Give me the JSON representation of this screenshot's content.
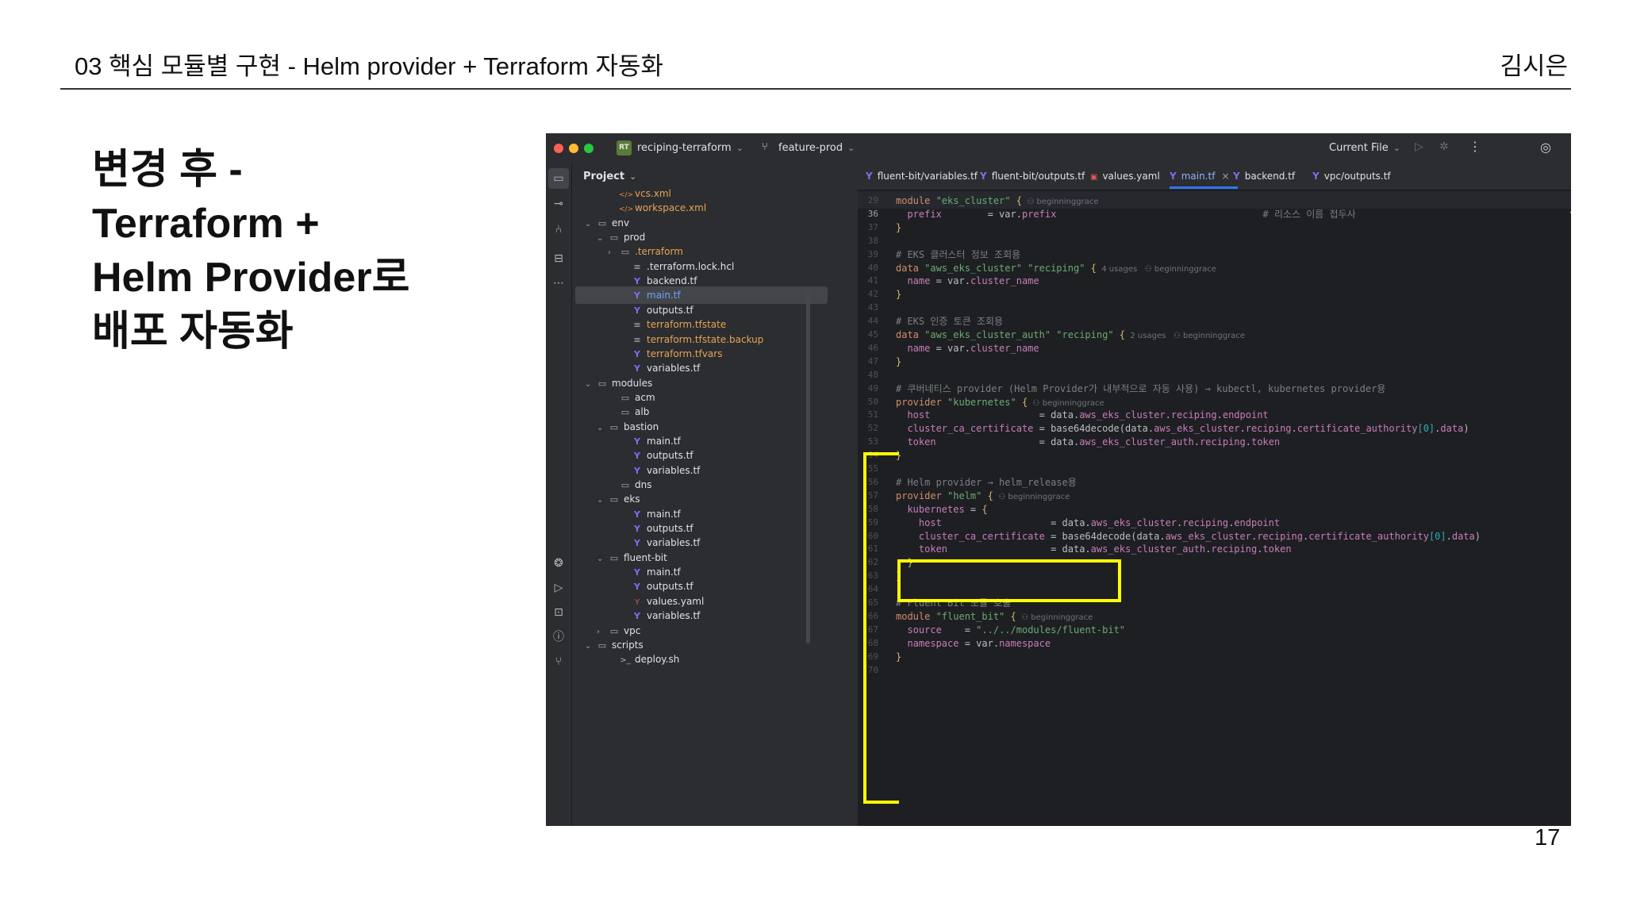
{
  "slide": {
    "title": "03 핵심 모듈별 구현 - Helm provider +  Terraform 자동화",
    "author": "김시은",
    "heading_lines": [
      "변경 후 -",
      "Terraform +",
      "Helm Provider로",
      "배포 자동화"
    ],
    "page_number": "17"
  },
  "ide": {
    "titlebar": {
      "project_badge": "RT",
      "project_name": "reciping-terraform",
      "branch_name": "feature-prod",
      "run_config": "Current File",
      "icons": [
        "chevron-down-icon",
        "git-branch-icon",
        "run-icon",
        "debug-icon",
        "more-icon",
        "ai-assistant-icon"
      ]
    },
    "toolstrip_icons": [
      "folder-icon",
      "commit-icon",
      "pull-request-icon",
      "structure-icon",
      "more-icon",
      "plugins-icon",
      "run-icon",
      "terminal-icon",
      "problems-icon",
      "git-icon"
    ],
    "project_panel": {
      "title": "Project",
      "tree": [
        {
          "label": "vcs.xml",
          "icon": "xml-file-icon",
          "depth": 3,
          "color": "orange"
        },
        {
          "label": "workspace.xml",
          "icon": "xml-file-icon",
          "depth": 3,
          "color": "orange"
        },
        {
          "label": "env",
          "icon": "folder-icon",
          "depth": 1,
          "expanded": true
        },
        {
          "label": "prod",
          "icon": "folder-icon",
          "depth": 2,
          "expanded": true
        },
        {
          "label": ".terraform",
          "icon": "folder-icon",
          "depth": 3,
          "expanded": false,
          "color": "orange"
        },
        {
          "label": ".terraform.lock.hcl",
          "icon": "lines-file-icon",
          "depth": 4
        },
        {
          "label": "backend.tf",
          "icon": "terraform-file-icon",
          "depth": 4
        },
        {
          "label": "main.tf",
          "icon": "terraform-file-icon",
          "depth": 4,
          "selected": true,
          "color": "blue"
        },
        {
          "label": "outputs.tf",
          "icon": "terraform-file-icon",
          "depth": 4
        },
        {
          "label": "terraform.tfstate",
          "icon": "lines-file-icon",
          "depth": 4,
          "color": "orange"
        },
        {
          "label": "terraform.tfstate.backup",
          "icon": "lines-file-icon",
          "depth": 4,
          "color": "orange"
        },
        {
          "label": "terraform.tfvars",
          "icon": "terraform-file-icon",
          "depth": 4,
          "color": "orange"
        },
        {
          "label": "variables.tf",
          "icon": "terraform-file-icon",
          "depth": 4
        },
        {
          "label": "modules",
          "icon": "folder-icon",
          "depth": 1,
          "expanded": true
        },
        {
          "label": "acm",
          "icon": "folder-icon",
          "depth": 3
        },
        {
          "label": "alb",
          "icon": "folder-icon",
          "depth": 3
        },
        {
          "label": "bastion",
          "icon": "folder-icon",
          "depth": 2,
          "expanded": true
        },
        {
          "label": "main.tf",
          "icon": "terraform-file-icon",
          "depth": 4
        },
        {
          "label": "outputs.tf",
          "icon": "terraform-file-icon",
          "depth": 4
        },
        {
          "label": "variables.tf",
          "icon": "terraform-file-icon",
          "depth": 4
        },
        {
          "label": "dns",
          "icon": "folder-icon",
          "depth": 3
        },
        {
          "label": "eks",
          "icon": "folder-icon",
          "depth": 2,
          "expanded": true
        },
        {
          "label": "main.tf",
          "icon": "terraform-file-icon",
          "depth": 4
        },
        {
          "label": "outputs.tf",
          "icon": "terraform-file-icon",
          "depth": 4
        },
        {
          "label": "variables.tf",
          "icon": "terraform-file-icon",
          "depth": 4
        },
        {
          "label": "fluent-bit",
          "icon": "folder-icon",
          "depth": 2,
          "expanded": true
        },
        {
          "label": "main.tf",
          "icon": "terraform-file-icon",
          "depth": 4
        },
        {
          "label": "outputs.tf",
          "icon": "terraform-file-icon",
          "depth": 4
        },
        {
          "label": "values.yaml",
          "icon": "yaml-file-icon",
          "depth": 4
        },
        {
          "label": "variables.tf",
          "icon": "terraform-file-icon",
          "depth": 4
        },
        {
          "label": "vpc",
          "icon": "folder-icon",
          "depth": 2,
          "expanded": false
        },
        {
          "label": "scripts",
          "icon": "folder-icon",
          "depth": 1,
          "expanded": true
        },
        {
          "label": "deploy.sh",
          "icon": "shell-file-icon",
          "depth": 3
        }
      ]
    },
    "tabs": [
      {
        "label": "fluent-bit/variables.tf",
        "icon": "terraform-file-icon"
      },
      {
        "label": "fluent-bit/outputs.tf",
        "icon": "terraform-file-icon"
      },
      {
        "label": "values.yaml",
        "icon": "yaml-file-icon"
      },
      {
        "label": "main.tf",
        "icon": "terraform-file-icon",
        "active": true,
        "close": "×"
      },
      {
        "label": "backend.tf",
        "icon": "terraform-file-icon"
      },
      {
        "label": "vpc/outputs.tf",
        "icon": "terraform-file-icon"
      }
    ],
    "editor": {
      "current_line": "36",
      "lines": [
        {
          "n": "29",
          "tokens": [
            [
              "k",
              "module "
            ],
            [
              "s",
              "\"eks_cluster\""
            ],
            [
              "t",
              " "
            ],
            [
              "br",
              "{"
            ],
            [
              "ann",
              "  ⚇ beginninggrace"
            ]
          ]
        },
        {
          "n": "36",
          "current": true,
          "tokens": [
            [
              "t",
              "  "
            ],
            [
              "p",
              "prefix"
            ],
            [
              "t",
              "        = var."
            ],
            [
              "p",
              "prefix"
            ],
            [
              "c",
              "                                    # 리소스 이름 접두사"
            ]
          ]
        },
        {
          "n": "37",
          "tokens": [
            [
              "br",
              "}"
            ]
          ]
        },
        {
          "n": "38",
          "tokens": []
        },
        {
          "n": "39",
          "tokens": [
            [
              "c",
              "# EKS 클러스터 정보 조회용"
            ]
          ]
        },
        {
          "n": "40",
          "tokens": [
            [
              "k",
              "data "
            ],
            [
              "s",
              "\"aws_eks_cluster\" \"reciping\""
            ],
            [
              "t",
              " "
            ],
            [
              "br",
              "{"
            ],
            [
              "ann",
              "  4 usages   ⚇ beginninggrace"
            ]
          ]
        },
        {
          "n": "41",
          "tokens": [
            [
              "t",
              "  "
            ],
            [
              "p",
              "name"
            ],
            [
              "t",
              " = var."
            ],
            [
              "p",
              "cluster_name"
            ]
          ]
        },
        {
          "n": "42",
          "tokens": [
            [
              "br",
              "}"
            ]
          ]
        },
        {
          "n": "43",
          "tokens": []
        },
        {
          "n": "44",
          "tokens": [
            [
              "c",
              "# EKS 인증 토큰 조회용"
            ]
          ]
        },
        {
          "n": "45",
          "tokens": [
            [
              "k",
              "data "
            ],
            [
              "s",
              "\"aws_eks_cluster_auth\" \"reciping\""
            ],
            [
              "t",
              " "
            ],
            [
              "br",
              "{"
            ],
            [
              "ann",
              "  2 usages   ⚇ beginninggrace"
            ]
          ]
        },
        {
          "n": "46",
          "tokens": [
            [
              "t",
              "  "
            ],
            [
              "p",
              "name"
            ],
            [
              "t",
              " = var."
            ],
            [
              "p",
              "cluster_name"
            ]
          ]
        },
        {
          "n": "47",
          "tokens": [
            [
              "br",
              "}"
            ]
          ]
        },
        {
          "n": "48",
          "tokens": []
        },
        {
          "n": "49",
          "tokens": [
            [
              "c",
              "# 쿠버네티스 provider (Helm Provider가 내부적으로 자동 사용) → kubectl, kubernetes provider용"
            ]
          ]
        },
        {
          "n": "50",
          "tokens": [
            [
              "k",
              "provider "
            ],
            [
              "s",
              "\"kubernetes\""
            ],
            [
              "t",
              " "
            ],
            [
              "br",
              "{"
            ],
            [
              "ann",
              "  ⚇ beginninggrace"
            ]
          ]
        },
        {
          "n": "51",
          "tokens": [
            [
              "t",
              "  "
            ],
            [
              "p",
              "host"
            ],
            [
              "t",
              "                   = data."
            ],
            [
              "p",
              "aws_eks_cluster"
            ],
            [
              "t",
              "."
            ],
            [
              "p",
              "reciping"
            ],
            [
              "t",
              "."
            ],
            [
              "p",
              "endpoint"
            ]
          ]
        },
        {
          "n": "52",
          "tokens": [
            [
              "t",
              "  "
            ],
            [
              "p",
              "cluster_ca_certificate"
            ],
            [
              "t",
              " = base64decode(data."
            ],
            [
              "p",
              "aws_eks_cluster"
            ],
            [
              "t",
              "."
            ],
            [
              "p",
              "reciping"
            ],
            [
              "t",
              "."
            ],
            [
              "p",
              "certificate_authority"
            ],
            [
              "idx",
              "[0]"
            ],
            [
              "t",
              "."
            ],
            [
              "p",
              "data"
            ],
            [
              "t",
              ")"
            ]
          ]
        },
        {
          "n": "53",
          "tokens": [
            [
              "t",
              "  "
            ],
            [
              "p",
              "token"
            ],
            [
              "t",
              "                  = data."
            ],
            [
              "p",
              "aws_eks_cluster_auth"
            ],
            [
              "t",
              "."
            ],
            [
              "p",
              "reciping"
            ],
            [
              "t",
              "."
            ],
            [
              "p",
              "token"
            ]
          ]
        },
        {
          "n": "54",
          "tokens": [
            [
              "br",
              "}"
            ]
          ]
        },
        {
          "n": "55",
          "tokens": []
        },
        {
          "n": "56",
          "tokens": [
            [
              "c",
              "# Helm provider → helm_release용"
            ]
          ]
        },
        {
          "n": "57",
          "tokens": [
            [
              "k",
              "provider "
            ],
            [
              "s",
              "\"helm\""
            ],
            [
              "t",
              " "
            ],
            [
              "br",
              "{"
            ],
            [
              "ann",
              "  ⚇ beginninggrace"
            ]
          ]
        },
        {
          "n": "58",
          "tokens": [
            [
              "t",
              "  "
            ],
            [
              "p",
              "kubernetes"
            ],
            [
              "t",
              " = "
            ],
            [
              "br",
              "{"
            ]
          ]
        },
        {
          "n": "59",
          "tokens": [
            [
              "t",
              "    "
            ],
            [
              "p",
              "host"
            ],
            [
              "t",
              "                   = data."
            ],
            [
              "p",
              "aws_eks_cluster"
            ],
            [
              "t",
              "."
            ],
            [
              "p",
              "reciping"
            ],
            [
              "t",
              "."
            ],
            [
              "p",
              "endpoint"
            ]
          ]
        },
        {
          "n": "60",
          "tokens": [
            [
              "t",
              "    "
            ],
            [
              "p",
              "cluster_ca_certificate"
            ],
            [
              "t",
              " = base64decode(data."
            ],
            [
              "p",
              "aws_eks_cluster"
            ],
            [
              "t",
              "."
            ],
            [
              "p",
              "reciping"
            ],
            [
              "t",
              "."
            ],
            [
              "p",
              "certificate_authority"
            ],
            [
              "idx",
              "[0]"
            ],
            [
              "t",
              "."
            ],
            [
              "p",
              "data"
            ],
            [
              "t",
              ")"
            ]
          ]
        },
        {
          "n": "61",
          "tokens": [
            [
              "t",
              "    "
            ],
            [
              "p",
              "token"
            ],
            [
              "t",
              "                  = data."
            ],
            [
              "p",
              "aws_eks_cluster_auth"
            ],
            [
              "t",
              "."
            ],
            [
              "p",
              "reciping"
            ],
            [
              "t",
              "."
            ],
            [
              "p",
              "token"
            ]
          ]
        },
        {
          "n": "62",
          "tokens": [
            [
              "t",
              "  "
            ],
            [
              "br",
              "}"
            ]
          ]
        },
        {
          "n": "63",
          "tokens": [
            [
              "br",
              "}"
            ]
          ]
        },
        {
          "n": "64",
          "tokens": []
        },
        {
          "n": "65",
          "tokens": [
            [
              "c",
              "# Fluent Bit 모듈 호출"
            ]
          ]
        },
        {
          "n": "66",
          "tokens": [
            [
              "k",
              "module "
            ],
            [
              "s",
              "\"fluent_bit\""
            ],
            [
              "t",
              " "
            ],
            [
              "br",
              "{"
            ],
            [
              "ann",
              "  ⚇ beginninggrace"
            ]
          ]
        },
        {
          "n": "67",
          "tokens": [
            [
              "t",
              "  "
            ],
            [
              "p",
              "source"
            ],
            [
              "t",
              "    = "
            ],
            [
              "s",
              "\"../../modules/fluent-bit\""
            ]
          ]
        },
        {
          "n": "68",
          "tokens": [
            [
              "t",
              "  "
            ],
            [
              "p",
              "namespace"
            ],
            [
              "t",
              " = var."
            ],
            [
              "p",
              "namespace"
            ]
          ]
        },
        {
          "n": "69",
          "tokens": [
            [
              "br",
              "}"
            ]
          ]
        },
        {
          "n": "70",
          "tokens": []
        }
      ]
    }
  },
  "colors": {
    "highlight": "#ffff00",
    "ide_background": "#1e1f22",
    "panel_background": "#2b2d30",
    "keyword": "#cf8e6d",
    "string": "#6aab73",
    "property": "#c77dbb",
    "comment": "#7a7e85",
    "active_tab": "#3574f0"
  }
}
